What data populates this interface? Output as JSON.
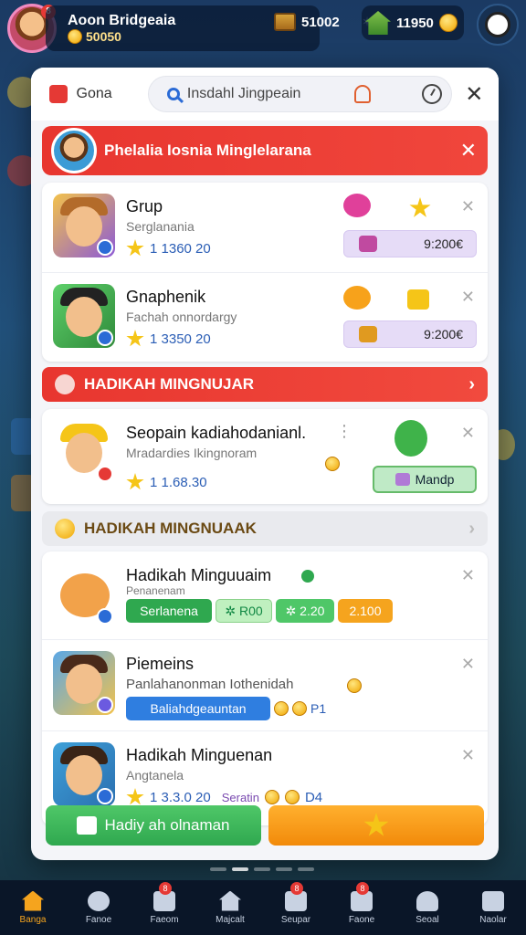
{
  "hud": {
    "name": "Aoon Bridgeaia",
    "coins": "50050",
    "avatar_badge": "8",
    "chest_value": "51002",
    "chest_mark": "✶",
    "house_value": "11950"
  },
  "modal": {
    "menu_label": "Gona",
    "search_value": "Insdahl Jingpeain",
    "close": "✕"
  },
  "banner": {
    "title": "Phelalia Iosnia Minglelarana",
    "close": "✕"
  },
  "group1": [
    {
      "title": "Grup",
      "subtitle": "Serglanania",
      "stat": "1 1360 20",
      "price": "9:200€",
      "close": "✕"
    },
    {
      "title": "Gnaphenik",
      "subtitle": "Fachah onnordargy",
      "stat": "1 3350 20",
      "price": "9:200€",
      "close": "✕"
    }
  ],
  "section1": {
    "title": "HADIKAH MINGNUJAR",
    "chevron": "›"
  },
  "group2": [
    {
      "title": "Seopain kadiahodanianl.",
      "subtitle": "Mradardies Ikingnoram",
      "stat": "1 1.68.30",
      "button": "Mandp",
      "close": "✕",
      "more": "⋮"
    }
  ],
  "section2": {
    "title": "HADIKAH MINGNUAAK",
    "chevron": "›"
  },
  "group3": [
    {
      "title": "Hadikah Minguuaim",
      "subtitle": "Penanenam",
      "tags": [
        "Serlanena",
        "✲ R00",
        "✲ 2.20",
        "2.100"
      ],
      "close": "✕"
    },
    {
      "title": "Piemeins",
      "subtitle": "Panlahanonman Iothenidah",
      "tag": "Baliahdgeauntan",
      "extra": "P1",
      "close": "✕"
    },
    {
      "title": "Hadikah Minguenan",
      "subtitle": "Angtanela",
      "stat": "1 3.3.0 20",
      "extra_label": "Seratin",
      "extra": "D4",
      "close": "✕"
    }
  ],
  "bottom": {
    "green_button": "Hadiy ah olnaman"
  },
  "nav": [
    {
      "label": "Banga",
      "active": true
    },
    {
      "label": "Fanoe"
    },
    {
      "label": "Faeom",
      "badge": "8"
    },
    {
      "label": "Majcalt"
    },
    {
      "label": "Seupar",
      "badge": "8"
    },
    {
      "label": "Faone",
      "badge": "8"
    },
    {
      "label": "Seoal"
    },
    {
      "label": "Naolar"
    }
  ]
}
